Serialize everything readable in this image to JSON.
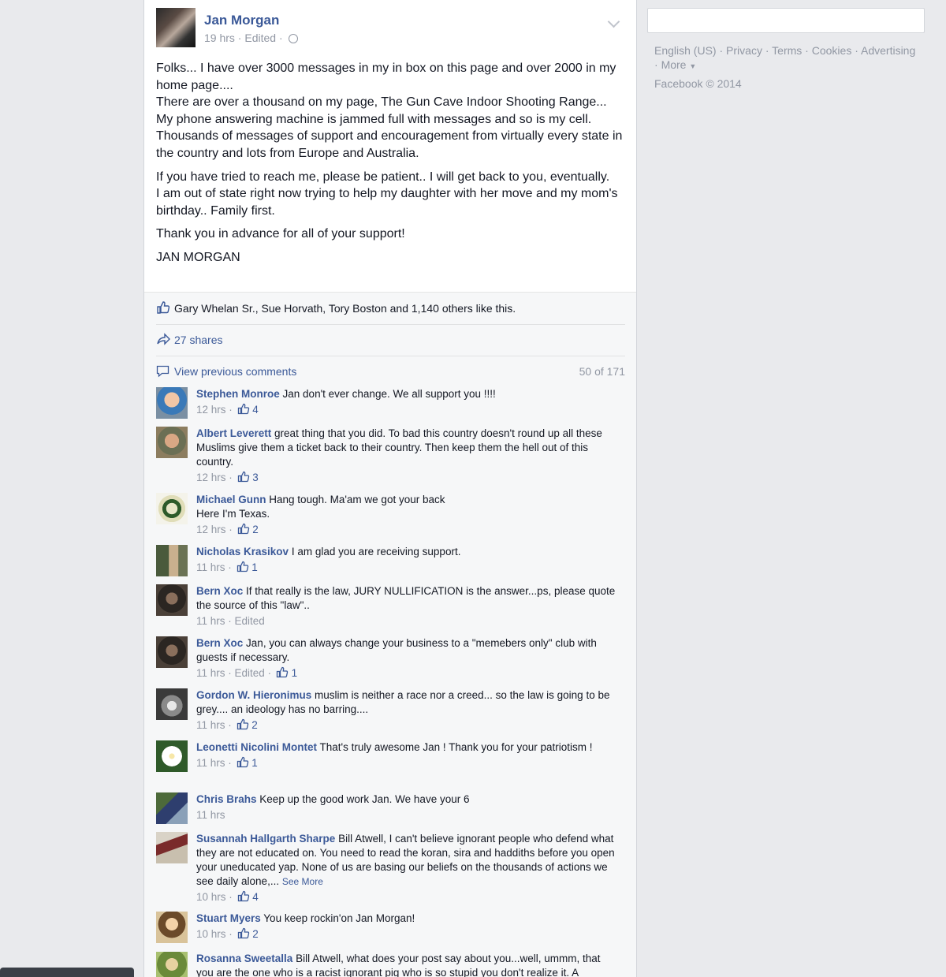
{
  "post": {
    "author": "Jan Morgan",
    "time": "19 hrs",
    "edited": "Edited",
    "paragraphs": [
      "Folks... I have over 3000 messages in my in box on this page and over 2000 in my home page....\nThere are over a thousand on my page, The Gun Cave Indoor Shooting Range...\nMy phone answering machine is jammed full with messages and so is my cell.\nThousands of messages of support and encouragement from virtually every state in the country and lots from Europe and Australia.",
      "If you have tried to reach me, please be patient.. I will get back to you, eventually.\nI am out of state right now trying to help my daughter with her move and my mom's birthday.. Family first.",
      "Thank you in advance for all of your support!",
      "JAN MORGAN"
    ]
  },
  "feedback": {
    "likes_text": "Gary Whelan Sr., Sue Horvath, Tory Boston and 1,140 others like this.",
    "shares_text": "27 shares",
    "view_previous": "View previous comments",
    "count": "50 of 171"
  },
  "comments": [
    {
      "name": "Stephen Monroe",
      "text": "Jan don't ever change. We all support you !!!!",
      "time": "12 hrs",
      "edited": "",
      "likes": "4",
      "see_more": ""
    },
    {
      "name": "Albert Leverett",
      "text": "great thing that you did. To bad this country doesn't round up all these Muslims give them a ticket back to their country. Then keep them the hell out of this country.",
      "time": "12 hrs",
      "edited": "",
      "likes": "3",
      "see_more": ""
    },
    {
      "name": "Michael Gunn",
      "text": "Hang tough. Ma'am we got your back\nHere I'm Texas.",
      "time": "12 hrs",
      "edited": "",
      "likes": "2",
      "see_more": ""
    },
    {
      "name": "Nicholas Krasikov",
      "text": "I am glad you are receiving support.",
      "time": "11 hrs",
      "edited": "",
      "likes": "1",
      "see_more": ""
    },
    {
      "name": "Bern Xoc",
      "text": "If that really is the law, JURY NULLIFICATION is the answer...ps, please quote the source of this \"law\"..",
      "time": "11 hrs",
      "edited": "Edited",
      "likes": "",
      "see_more": ""
    },
    {
      "name": "Bern Xoc",
      "text": "Jan, you can always change your business to a \"memebers only\" club with guests if necessary.",
      "time": "11 hrs",
      "edited": "Edited",
      "likes": "1",
      "see_more": ""
    },
    {
      "name": "Gordon W. Hieronimus",
      "text": "muslim is neither a race nor a creed... so the law is going to be grey.... an ideology has no barring....",
      "time": "11 hrs",
      "edited": "",
      "likes": "2",
      "see_more": ""
    },
    {
      "name": "Leonetti Nicolini Montet",
      "text": "That's truly awesome Jan ! Thank you for your patriotism !",
      "time": "11 hrs",
      "edited": "",
      "likes": "1",
      "see_more": ""
    },
    {
      "name": "Chris Brahs",
      "text": "Keep up the good work Jan. We have your 6",
      "time": "11 hrs",
      "edited": "",
      "likes": "",
      "see_more": ""
    },
    {
      "name": "Susannah Hallgarth Sharpe",
      "text": "Bill Atwell, I can't believe ignorant people who defend what they are not educated on. You need to read the koran, sira and haddiths before you open your uneducated yap. None of us are basing our beliefs on the thousands of actions we see daily alone,...",
      "time": "10 hrs",
      "edited": "",
      "likes": "4",
      "see_more": "See More"
    },
    {
      "name": "Stuart Myers",
      "text": "You keep rockin'on Jan Morgan!",
      "time": "10 hrs",
      "edited": "",
      "likes": "2",
      "see_more": ""
    },
    {
      "name": "Rosanna Sweetalla",
      "text": "Bill Atwell, what does your post say about you...well, ummm, that you are the one who is a racist ignorant pig who is so stupid you don't realize it. A",
      "time": "",
      "edited": "",
      "likes": "",
      "see_more": ""
    }
  ],
  "sidebar": {
    "links": [
      "English (US)",
      "Privacy",
      "Terms",
      "Cookies",
      "Advertising",
      "More"
    ],
    "copyright": "Facebook © 2014"
  },
  "colors": {
    "link": "#3b5998",
    "muted": "#9197a3",
    "background": "#e9eaed"
  }
}
